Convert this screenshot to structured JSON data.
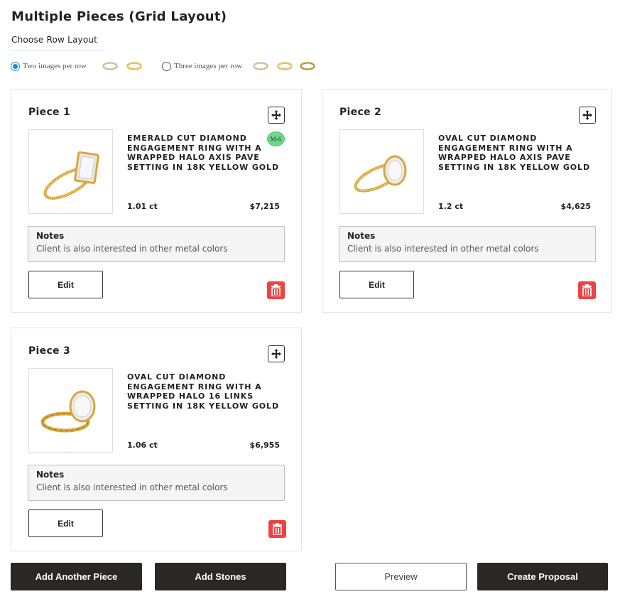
{
  "page": {
    "title": "Multiple Pieces (Grid Layout)",
    "row_layout_label": "Choose Row Layout"
  },
  "layout_options": [
    {
      "label": "Two images per row",
      "selected": true,
      "ring_icons": [
        "ring-thumb-icon",
        "ring-thumb-icon"
      ]
    },
    {
      "label": "Three images per row",
      "selected": false,
      "ring_icons": [
        "ring-thumb-icon",
        "ring-thumb-icon",
        "ring-thumb-icon"
      ]
    }
  ],
  "pieces": [
    {
      "title": "Piece 1",
      "name": "EMERALD CUT DIAMOND ENGAGEMENT RING WITH A WRAPPED HALO AXIS PAVE SETTING IN 18K YELLOW GOLD",
      "badge": "M-6",
      "carat": "1.01 ct",
      "price": "$7,215",
      "notes_label": "Notes",
      "notes_text": "Client is also interested in other metal colors",
      "edit_label": "Edit",
      "image_icon": "emerald-cut-ring-image"
    },
    {
      "title": "Piece 2",
      "name": "OVAL CUT DIAMOND ENGAGEMENT RING WITH A WRAPPED HALO AXIS PAVE SETTING IN 18K YELLOW GOLD",
      "carat": "1.2 ct",
      "price": "$4,625",
      "notes_label": "Notes",
      "notes_text": "Client is also interested in other metal colors",
      "edit_label": "Edit",
      "image_icon": "oval-cut-ring-image"
    },
    {
      "title": "Piece 3",
      "name": "OVAL CUT DIAMOND ENGAGEMENT RING WITH A WRAPPED HALO 16 LINKS SETTING IN 18K YELLOW GOLD",
      "carat": "1.06 ct",
      "price": "$6,955",
      "notes_label": "Notes",
      "notes_text": "Client is also interested in other metal colors",
      "edit_label": "Edit",
      "image_icon": "oval-link-ring-image"
    }
  ],
  "actions": {
    "add_piece": "Add Another Piece",
    "add_stones": "Add Stones",
    "preview": "Preview",
    "create_proposal": "Create Proposal"
  },
  "colors": {
    "accent_radio": "#1e88e5",
    "badge_green": "#6fd98b",
    "trash_red": "#ef4343",
    "dark_button": "#2b2726",
    "gold": "#d8a93c"
  }
}
